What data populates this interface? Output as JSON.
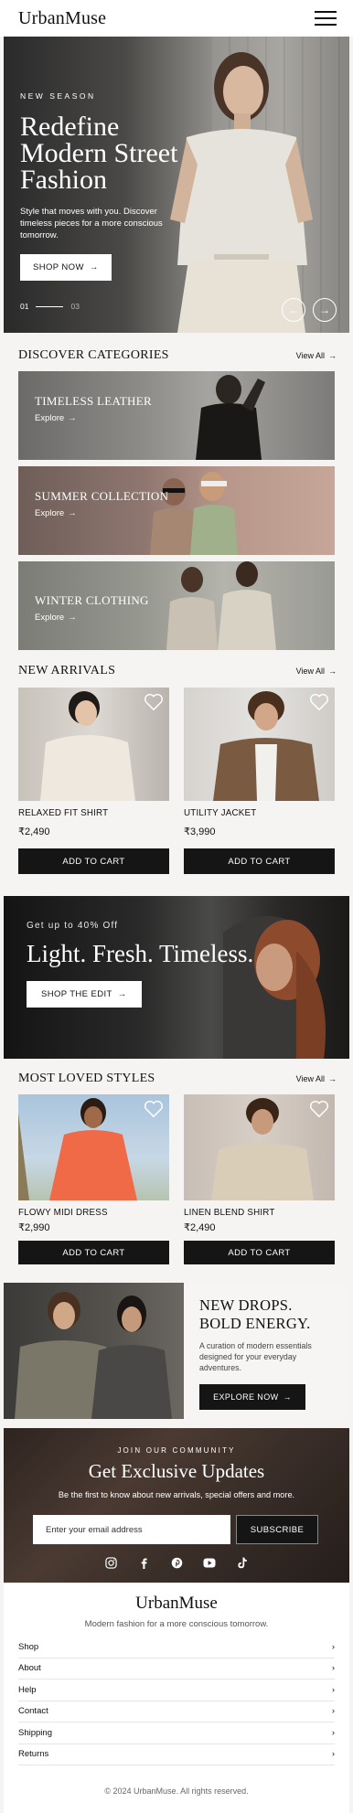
{
  "header": {
    "logo": "UrbanMuse",
    "menu_icon": "hamburger-icon"
  },
  "hero": {
    "kicker": "NEW SEASON",
    "title": "Redefine Modern Street Fashion",
    "text": "Style that moves with you. Discover timeless pieces for a more conscious tomorrow.",
    "cta": "SHOP NOW",
    "slide_current": "01",
    "slide_total": "03"
  },
  "categories": {
    "title": "DISCOVER CATEGORIES",
    "view_all": "View All",
    "items": [
      {
        "title": "TIMELESS LEATHER",
        "cta": "Explore"
      },
      {
        "title": "SUMMER COLLECTION",
        "cta": "Explore"
      },
      {
        "title": "WINTER CLOTHING",
        "cta": "Explore"
      }
    ]
  },
  "new_arrivals": {
    "title": "NEW ARRIVALS",
    "view_all": "View All",
    "items": [
      {
        "name": "RELAXED FIT SHIRT",
        "price": "₹2,490",
        "cta": "ADD TO CART"
      },
      {
        "name": "UTILITY JACKET",
        "price": "₹3,990",
        "cta": "ADD TO CART"
      }
    ]
  },
  "promo": {
    "kicker": "Get up to 40% Off",
    "title": "Light. Fresh. Timeless.",
    "cta": "SHOP THE EDIT"
  },
  "most_loved": {
    "title": "MOST LOVED STYLES",
    "view_all": "View All",
    "items": [
      {
        "name": "FLOWY MIDI DRESS",
        "price": "₹2,990",
        "cta": "ADD TO CART"
      },
      {
        "name": "LINEN BLEND SHIRT",
        "price": "₹2,490",
        "cta": "ADD TO CART"
      }
    ]
  },
  "drops": {
    "title": "NEW DROPS. BOLD ENERGY.",
    "text": "A curation of modern essentials designed for your everyday adventures.",
    "cta": "EXPLORE NOW"
  },
  "newsletter": {
    "kicker": "JOIN OUR COMMUNITY",
    "title": "Get Exclusive Updates",
    "text": "Be the first to know about new arrivals, special offers and more.",
    "placeholder": "Enter your email address",
    "cta": "SUBSCRIBE",
    "socials": [
      "instagram-icon",
      "facebook-icon",
      "pinterest-icon",
      "youtube-icon",
      "tiktok-icon"
    ]
  },
  "footer": {
    "logo": "UrbanMuse",
    "tagline": "Modern fashion for a more conscious tomorrow.",
    "links": [
      "Shop",
      "About",
      "Help",
      "Contact",
      "Shipping",
      "Returns"
    ],
    "copyright": "© 2024 UrbanMuse. All rights reserved."
  }
}
